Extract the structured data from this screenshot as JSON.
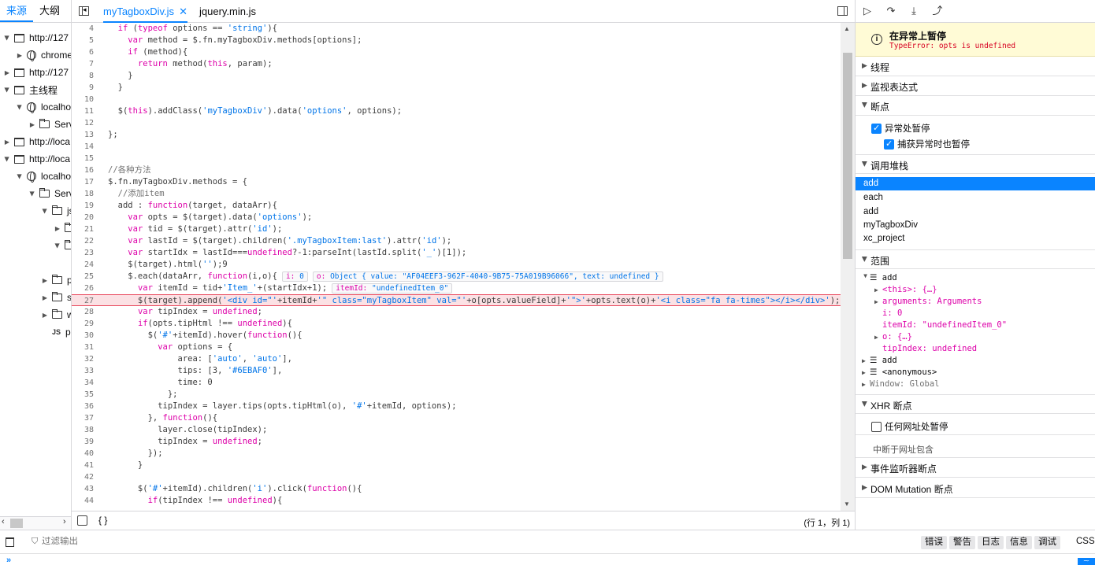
{
  "left_panel": {
    "tabs": [
      "来源",
      "大纲"
    ],
    "tree": [
      {
        "label": "http://127",
        "icon": "frame-icon",
        "open": true,
        "indent": 0
      },
      {
        "label": "chrome",
        "icon": "globe-icon",
        "open": false,
        "indent": 1
      },
      {
        "label": "http://127",
        "icon": "frame-icon",
        "open": false,
        "indent": 0
      },
      {
        "label": "主线程",
        "icon": "frame-icon",
        "open": true,
        "indent": 0
      },
      {
        "label": "localho",
        "icon": "globe-icon",
        "open": true,
        "indent": 1
      },
      {
        "label": "Serv",
        "icon": "folder-icon",
        "open": false,
        "indent": 2
      },
      {
        "label": "http://loca",
        "icon": "frame-icon",
        "open": false,
        "indent": 0
      },
      {
        "label": "http://loca",
        "icon": "frame-icon",
        "open": true,
        "indent": 0
      },
      {
        "label": "localho",
        "icon": "globe-icon",
        "open": true,
        "indent": 1
      },
      {
        "label": "Serv",
        "icon": "folder-icon",
        "open": true,
        "indent": 2
      },
      {
        "label": "js",
        "icon": "folder-icon",
        "open": true,
        "indent": 3
      },
      {
        "label": "",
        "icon": "folder-icon",
        "open": false,
        "indent": 4
      },
      {
        "label": "",
        "icon": "folder-icon",
        "open": true,
        "indent": 4
      },
      {
        "label": "",
        "icon": "",
        "open": null,
        "indent": 4
      },
      {
        "label": "p",
        "icon": "folder-icon",
        "open": false,
        "indent": 3
      },
      {
        "label": "s",
        "icon": "folder-icon",
        "open": false,
        "indent": 3
      },
      {
        "label": "w",
        "icon": "folder-icon",
        "open": false,
        "indent": 3
      },
      {
        "label": "p",
        "icon": "js-icon",
        "open": null,
        "indent": 3
      }
    ]
  },
  "editor": {
    "tabs": [
      {
        "label": "myTagboxDiv.js",
        "active": true,
        "closable": true
      },
      {
        "label": "jquery.min.js",
        "active": false,
        "closable": false
      }
    ],
    "breakpoint_line": 27,
    "lines": [
      {
        "n": 4,
        "code": "  if (typeof options == 'string'){"
      },
      {
        "n": 5,
        "code": "    var method = $.fn.myTagboxDiv.methods[options];"
      },
      {
        "n": 6,
        "code": "    if (method){"
      },
      {
        "n": 7,
        "code": "      return method(this, param);"
      },
      {
        "n": 8,
        "code": "    }"
      },
      {
        "n": 9,
        "code": "  }"
      },
      {
        "n": 10,
        "code": ""
      },
      {
        "n": 11,
        "code": "  $(this).addClass('myTagboxDiv').data('options', options);"
      },
      {
        "n": 12,
        "code": ""
      },
      {
        "n": 13,
        "code": "};"
      },
      {
        "n": 14,
        "code": ""
      },
      {
        "n": 15,
        "code": ""
      },
      {
        "n": 16,
        "code": "//各种方法"
      },
      {
        "n": 17,
        "code": "$.fn.myTagboxDiv.methods = {"
      },
      {
        "n": 18,
        "code": "  //添加item"
      },
      {
        "n": 19,
        "code": "  add : function(target, dataArr){"
      },
      {
        "n": 20,
        "code": "    var opts = $(target).data('options');"
      },
      {
        "n": 21,
        "code": "    var tid = $(target).attr('id');"
      },
      {
        "n": 22,
        "code": "    var lastId = $(target).children('.myTagboxItem:last').attr('id');"
      },
      {
        "n": 23,
        "code": "    var startIdx = lastId===undefined?-1:parseInt(lastId.split('_')[1]);"
      },
      {
        "n": 24,
        "code": "    $(target).html('');9"
      },
      {
        "n": 25,
        "code": "    $.each(dataArr, function(i,o){"
      },
      {
        "n": 26,
        "code": "      var itemId = tid+'Item_'+(startIdx+1);"
      },
      {
        "n": 27,
        "code": "      $(target).append('<div id=\"'+itemId+'\" class=\"myTagboxItem\" val=\"'+o[opts.valueField]+'\">'+opts.text(o)+'<i class=\"fa fa-times\"></i></div>');"
      },
      {
        "n": 28,
        "code": "      var tipIndex = undefined;"
      },
      {
        "n": 29,
        "code": "      if(opts.tipHtml !== undefined){"
      },
      {
        "n": 30,
        "code": "        $('#'+itemId).hover(function(){"
      },
      {
        "n": 31,
        "code": "          var options = {"
      },
      {
        "n": 32,
        "code": "              area: ['auto', 'auto'],"
      },
      {
        "n": 33,
        "code": "              tips: [3, '#6EBAF0'],"
      },
      {
        "n": 34,
        "code": "              time: 0"
      },
      {
        "n": 35,
        "code": "            };"
      },
      {
        "n": 36,
        "code": "          tipIndex = layer.tips(opts.tipHtml(o), '#'+itemId, options);"
      },
      {
        "n": 37,
        "code": "        }, function(){"
      },
      {
        "n": 38,
        "code": "          layer.close(tipIndex);"
      },
      {
        "n": 39,
        "code": "          tipIndex = undefined;"
      },
      {
        "n": 40,
        "code": "        });"
      },
      {
        "n": 41,
        "code": "      }"
      },
      {
        "n": 42,
        "code": ""
      },
      {
        "n": 43,
        "code": "      $('#'+itemId).children('i').click(function(){"
      },
      {
        "n": 44,
        "code": "        if(tipIndex !== undefined){"
      }
    ],
    "preview_25": {
      "i_label": "i:",
      "i_value": "0",
      "o_label": "o:",
      "o_value": "Object { value: \"AF04EEF3-962F-4040-9B75-75A019B96066\", text: undefined }"
    },
    "preview_26": {
      "label": "itemId:",
      "value": "\"undefinedItem_0\""
    },
    "footer": {
      "braces": "{ }",
      "position": "(行 1，列 1)"
    }
  },
  "debugger": {
    "pause": {
      "title": "在异常上暂停",
      "error": "TypeError: opts is undefined"
    },
    "sections": {
      "threads": "线程",
      "watch": "监视表达式",
      "breakpoints": "断点",
      "callstack": "调用堆栈",
      "scopes": "范围",
      "xhr": "XHR 断点",
      "events": "事件监听器断点",
      "dom": "DOM Mutation 断点"
    },
    "pause_on_exceptions": "异常处暂停",
    "pause_on_caught": "捕获异常时也暂停",
    "frames": [
      "add",
      "each",
      "add",
      "myTagboxDiv",
      "xc_project"
    ],
    "scopes": {
      "add": "add",
      "this": "<this>: {…}",
      "arguments": "arguments: Arguments",
      "i": "i: 0",
      "itemId": "itemId: \"undefinedItem_0\"",
      "o": "o: {…}",
      "tipIndex": "tipIndex: undefined",
      "add2": "add",
      "anon": "<anonymous>",
      "window": "Window: Global"
    },
    "xhr_any": "任何网址处暂停",
    "xhr_url_placeholder": "中断于网址包含"
  },
  "console": {
    "filter_placeholder": "过滤输出",
    "levels": [
      "错误",
      "警告",
      "日志",
      "信息",
      "调试"
    ],
    "css": "CSS",
    "prompt": "»"
  }
}
